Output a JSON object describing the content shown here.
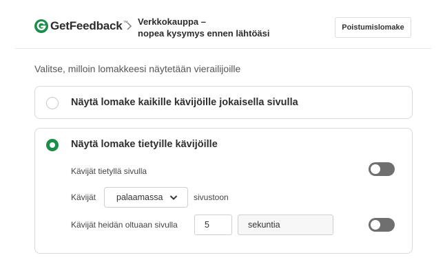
{
  "header": {
    "logo_text": "GetFeedback",
    "logo_tm": "™",
    "title_line1": "Verkkokauppa –",
    "title_line2": "nopea kysymys ennen lähtöäsi",
    "exit_form_button": "Poistumislomake"
  },
  "main": {
    "instruction": "Valitse, milloin lomakkeesi näytetään vierailijoille",
    "options": [
      {
        "label": "Näytä lomake kaikille kävijöille jokaisella sivulla",
        "selected": false
      },
      {
        "label": "Näytä lomake tietyille kävijöille",
        "selected": true
      }
    ],
    "conditions": {
      "specific_page_label": "Kävijät tietyllä sivulla",
      "specific_page_toggle": false,
      "returning_prefix": "Kävijät",
      "returning_select_value": "palaamassa",
      "returning_suffix": "sivustoon",
      "time_label": "Kävijät heidän oltuaan sivulla",
      "time_value": "5",
      "time_unit": "sekuntia",
      "time_toggle": false
    }
  },
  "colors": {
    "brand_green": "#1b8e4a",
    "toggle_off": "#6f6f6f"
  }
}
